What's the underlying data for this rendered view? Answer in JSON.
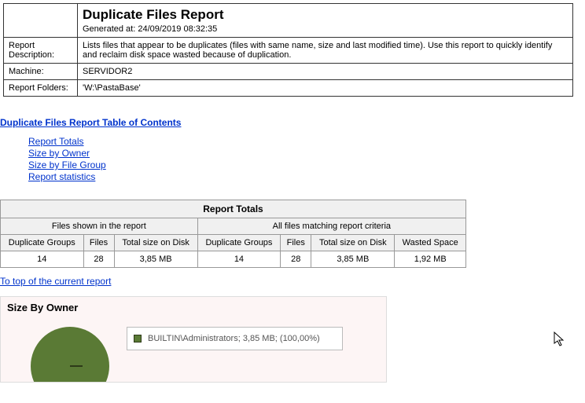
{
  "header": {
    "title": "Duplicate Files Report",
    "generated_label": "Generated at:",
    "generated_at": "24/09/2019 08:32:35"
  },
  "info_rows": {
    "description_label": "Report Description:",
    "description_value": "Lists files that appear to be duplicates (files with same name, size and last modified time). Use this report to quickly identify and reclaim disk space wasted because of duplication.",
    "machine_label": "Machine:",
    "machine_value": "SERVIDOR2",
    "folders_label": "Report Folders:",
    "folders_value": "'W:\\PastaBase'"
  },
  "toc": {
    "title": "Duplicate Files Report Table of Contents",
    "items": [
      "Report Totals",
      "Size by Owner",
      "Size by File Group",
      "Report statistics"
    ]
  },
  "totals": {
    "section_title": "Report Totals",
    "group_left": "Files shown in the report",
    "group_right": "All files matching report criteria",
    "headers": {
      "dup_groups": "Duplicate Groups",
      "files": "Files",
      "total_size": "Total size on Disk",
      "wasted": "Wasted Space"
    },
    "left": {
      "dup_groups": "14",
      "files": "28",
      "total_size": "3,85 MB"
    },
    "right": {
      "dup_groups": "14",
      "files": "28",
      "total_size": "3,85 MB",
      "wasted": "1,92 MB"
    }
  },
  "nav": {
    "to_top": "To top of the current report"
  },
  "owner": {
    "title": "Size By Owner",
    "legend_text": "BUILTIN\\Administrators; 3,85 MB; (100,00%)"
  },
  "chart_data": {
    "type": "pie",
    "title": "Size By Owner",
    "series": [
      {
        "name": "BUILTIN\\Administrators",
        "value_mb": 3.85,
        "percent": 100.0
      }
    ]
  }
}
